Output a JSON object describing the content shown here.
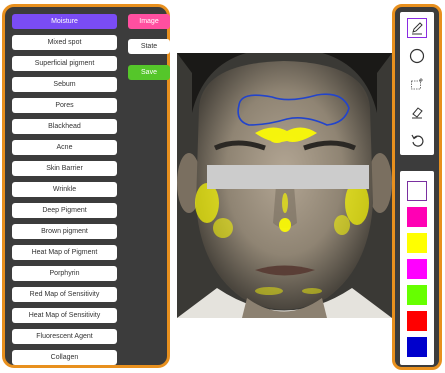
{
  "categories": [
    "Moisture",
    "Mixed spot",
    "Superficial pigment",
    "Sebum",
    "Pores",
    "Blackhead",
    "Acne",
    "Skin Barrier",
    "Wrinkle",
    "Deep Pigment",
    "Brown pigment",
    "Heat Map of Pigment",
    "Porphyrin",
    "Red Map of Sensitivity",
    "Heat Map of Sensitivity",
    "Fluorescent Agent",
    "Collagen"
  ],
  "active_category": "Moisture",
  "side_buttons": {
    "image_label": "Image",
    "state_label": "State",
    "save_label": "Save"
  },
  "tools": [
    "pen-icon",
    "circle-icon",
    "rectangle-icon",
    "eraser-icon",
    "undo-icon"
  ],
  "colors": [
    "#ffffff",
    "#ff00b4",
    "#ffff00",
    "#ff00ff",
    "#66ff00",
    "#ff0000",
    "#0000cc"
  ],
  "theme": {
    "panel_bg": "#3c3c3c",
    "panel_border": "#e8901e",
    "active_category": "#7a4cf5",
    "image_button": "#ff4fa0",
    "save_button": "#55c62a"
  }
}
